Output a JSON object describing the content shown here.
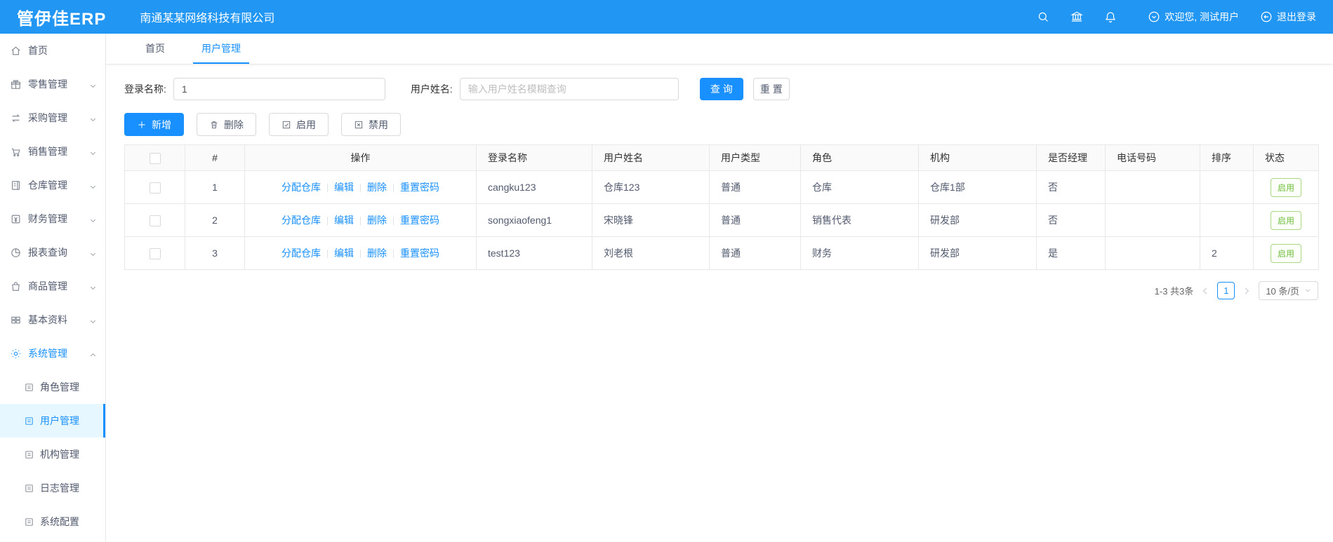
{
  "colors": {
    "header_bg": "#2196f3",
    "primary": "#1890ff",
    "active_menu_bg": "#e6f7ff",
    "status_green": "#6ebe3b"
  },
  "header": {
    "logo": "管伊佳ERP",
    "company": "南通某某网络科技有限公司",
    "welcome": "欢迎您, 测试用户",
    "logout": "退出登录"
  },
  "sidebar": {
    "items": [
      {
        "label": "首页"
      },
      {
        "label": "零售管理"
      },
      {
        "label": "采购管理"
      },
      {
        "label": "销售管理"
      },
      {
        "label": "仓库管理"
      },
      {
        "label": "财务管理"
      },
      {
        "label": "报表查询"
      },
      {
        "label": "商品管理"
      },
      {
        "label": "基本资料"
      },
      {
        "label": "系统管理"
      }
    ],
    "submenu": [
      {
        "label": "角色管理"
      },
      {
        "label": "用户管理"
      },
      {
        "label": "机构管理"
      },
      {
        "label": "日志管理"
      },
      {
        "label": "系统配置"
      }
    ]
  },
  "tabs": [
    {
      "label": "首页"
    },
    {
      "label": "用户管理"
    }
  ],
  "filters": {
    "login_label": "登录名称:",
    "login_value": "1",
    "name_label": "用户姓名:",
    "name_placeholder": "输入用户姓名模糊查询",
    "search": "查 询",
    "reset": "重 置"
  },
  "toolbar": {
    "add": "新增",
    "delete": "删除",
    "enable": "启用",
    "disable": "禁用"
  },
  "table": {
    "columns": [
      "#",
      "操作",
      "登录名称",
      "用户姓名",
      "用户类型",
      "角色",
      "机构",
      "是否经理",
      "电话号码",
      "排序",
      "状态"
    ],
    "operations": [
      "分配仓库",
      "编辑",
      "删除",
      "重置密码"
    ],
    "rows": [
      {
        "index": "1",
        "login": "cangku123",
        "name": "仓库123",
        "type": "普通",
        "role": "仓库",
        "org": "仓库1部",
        "manager": "否",
        "phone": "",
        "sort": "",
        "status": "启用"
      },
      {
        "index": "2",
        "login": "songxiaofeng1",
        "name": "宋晓锋",
        "type": "普通",
        "role": "销售代表",
        "org": "研发部",
        "manager": "否",
        "phone": "",
        "sort": "",
        "status": "启用"
      },
      {
        "index": "3",
        "login": "test123",
        "name": "刘老根",
        "type": "普通",
        "role": "财务",
        "org": "研发部",
        "manager": "是",
        "phone": "",
        "sort": "2",
        "status": "启用"
      }
    ]
  },
  "pagination": {
    "total": "1-3 共3条",
    "page": "1",
    "page_size": "10 条/页"
  }
}
